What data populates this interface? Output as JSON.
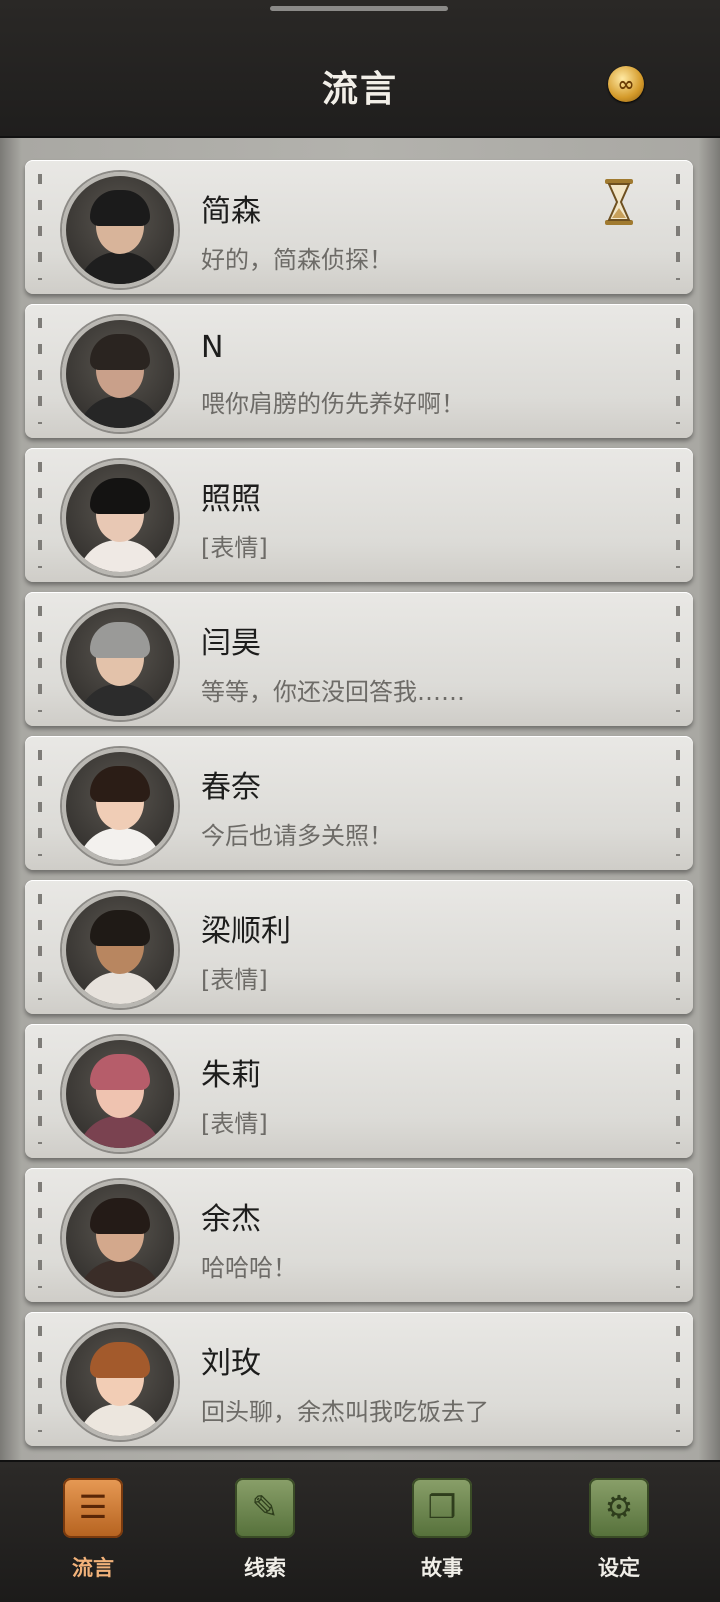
{
  "header": {
    "title": "流言",
    "badge_icon": "infinity-coin-icon",
    "badge_symbol": "∞"
  },
  "conversations": [
    {
      "name": "简森",
      "message": "好的，简森侦探！",
      "status_icon": "hourglass-icon",
      "skin": "#d8b49a",
      "hair": "#1b1b1b",
      "body": "#1e1e1e"
    },
    {
      "name": "N",
      "message": "喂你肩膀的伤先养好啊！",
      "skin": "#c9a08a",
      "hair": "#2a2420",
      "body": "#262626"
    },
    {
      "name": "照照",
      "message": "[表情]",
      "skin": "#e8c8b4",
      "hair": "#141312",
      "body": "#efe9e4"
    },
    {
      "name": "闫昊",
      "message": "等等，你还没回答我……",
      "skin": "#e3c2aa",
      "hair": "#9a9a98",
      "body": "#2c2c2c"
    },
    {
      "name": "春奈",
      "message": "今后也请多关照！",
      "skin": "#f0cdb6",
      "hair": "#2b1d16",
      "body": "#f3f1ee"
    },
    {
      "name": "梁顺利",
      "message": "[表情]",
      "skin": "#b88660",
      "hair": "#1f1a16",
      "body": "#e7e2dc"
    },
    {
      "name": "朱莉",
      "message": "[表情]",
      "skin": "#efc3b0",
      "hair": "#b65d6a",
      "body": "#7a4250"
    },
    {
      "name": "余杰",
      "message": "哈哈哈！",
      "skin": "#d3a88c",
      "hair": "#241b17",
      "body": "#3a2d28"
    },
    {
      "name": "刘玫",
      "message": "回头聊，余杰叫我吃饭去了",
      "skin": "#f2cdb5",
      "hair": "#a35a2c",
      "body": "#ece6de"
    }
  ],
  "nav": [
    {
      "label": "流言",
      "icon": "chat-document-icon",
      "glyph": "☰",
      "active": true
    },
    {
      "label": "线索",
      "icon": "notepad-pencil-icon",
      "glyph": "✎",
      "active": false
    },
    {
      "label": "故事",
      "icon": "open-book-icon",
      "glyph": "❒",
      "active": false
    },
    {
      "label": "设定",
      "icon": "gears-icon",
      "glyph": "⚙",
      "active": false
    }
  ]
}
